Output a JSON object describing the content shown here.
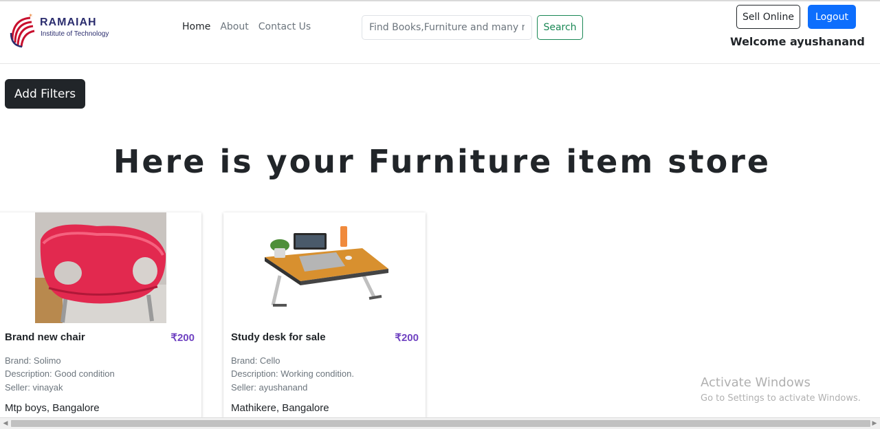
{
  "header": {
    "logo": {
      "title": "RAMAIAH",
      "subtitle": "Institute of Technology"
    },
    "nav": [
      {
        "label": "Home",
        "active": true
      },
      {
        "label": "About",
        "active": false
      },
      {
        "label": "Contact Us",
        "active": false
      }
    ],
    "search": {
      "placeholder": "Find Books,Furniture and many more",
      "button_label": "Search"
    },
    "sell_label": "Sell Online",
    "logout_label": "Logout",
    "welcome": "Welcome ayushanand"
  },
  "filters_label": "Add Filters",
  "page_title": "Here is your Furniture item store",
  "cards": [
    {
      "title": "Brand new chair",
      "price": "₹200",
      "brand": "Brand: Solimo",
      "description": "Description: Good condition",
      "seller": "Seller: vinayak",
      "location": "Mtp boys, Bangalore"
    },
    {
      "title": "Study desk for sale",
      "price": "₹200",
      "brand": "Brand: Cello",
      "description": "Description: Working condition.",
      "seller": "Seller: ayushanand",
      "location": "Mathikere, Bangalore"
    }
  ],
  "watermark": {
    "title": "Activate Windows",
    "subtitle": "Go to Settings to activate Windows."
  },
  "colors": {
    "primary": "#0d6efd",
    "success": "#198754",
    "dark": "#212529",
    "price": "#6f42c1",
    "logo": "#2b2d6e",
    "logo_accent": "#c8102e"
  }
}
